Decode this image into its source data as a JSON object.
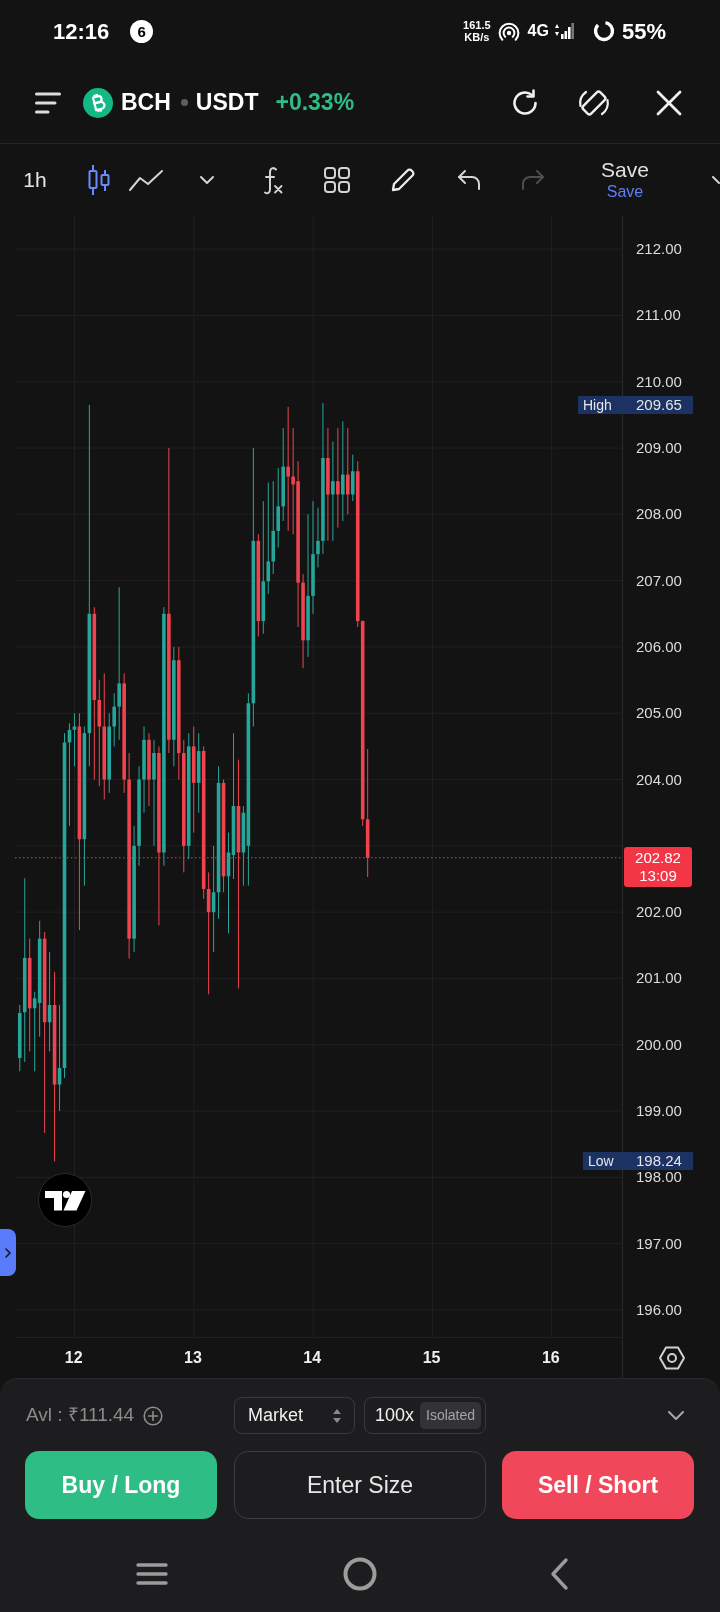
{
  "status_bar": {
    "time": "12:16",
    "notification_count": "6",
    "net_speed": "161.5",
    "net_speed_unit": "KB/s",
    "network_type": "4G",
    "battery": "55%"
  },
  "header": {
    "base": "BCH",
    "quote": "USDT",
    "change": "+0.33%"
  },
  "toolbar": {
    "interval": "1h",
    "chart_types": [
      {
        "kind": "candles",
        "selected": true
      },
      {
        "kind": "line",
        "selected": false
      }
    ],
    "history": [
      {
        "kind": "undo",
        "disabled": false
      },
      {
        "kind": "redo",
        "disabled": true
      }
    ],
    "save": {
      "label": "Save",
      "status": "Save"
    }
  },
  "chart": {
    "price_labels_upper": [
      "212.00",
      "211.00",
      "210.00",
      "209.00",
      "208.00",
      "207.00",
      "206.00",
      "205.00",
      "204.00"
    ],
    "price_labels_lower": [
      "202.00",
      "201.00",
      "200.00",
      "199.00",
      "198.00",
      "197.00",
      "196.00"
    ],
    "time_labels": [
      "12",
      "13",
      "14",
      "15",
      "16"
    ],
    "high": {
      "label": "High",
      "value": "209.65"
    },
    "low": {
      "label": "Low",
      "value": "198.24"
    },
    "last_price": {
      "value": "202.82",
      "countdown": "13:09"
    }
  },
  "order_panel": {
    "available": "Avl : ₹111.44",
    "order_type": "Market",
    "leverage": "100x",
    "margin_mode": "Isolated",
    "size": {
      "placeholder": "Enter Size"
    },
    "buy": "Buy / Long",
    "sell": "Sell / Short"
  }
}
